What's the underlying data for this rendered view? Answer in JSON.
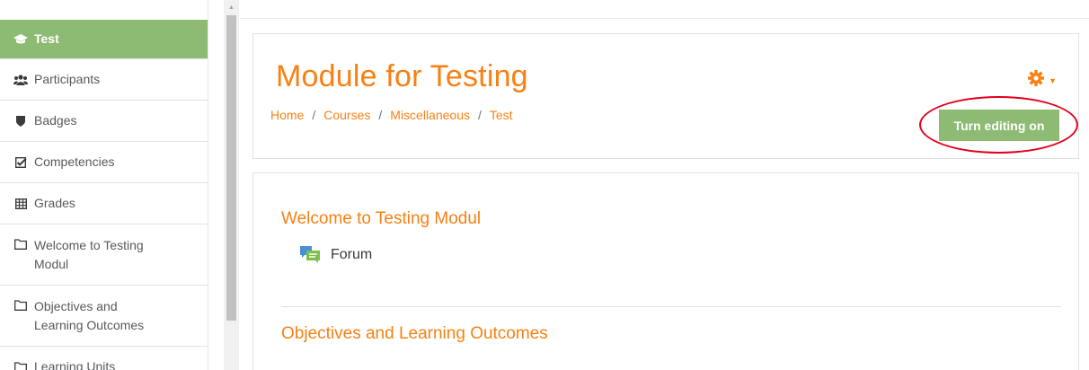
{
  "sidebar": {
    "items": [
      {
        "label": "Test",
        "icon": "graduation-cap-icon",
        "glyph": "🎓",
        "active": true
      },
      {
        "label": "Participants",
        "icon": "users-icon",
        "glyph": "👥"
      },
      {
        "label": "Badges",
        "icon": "shield-icon",
        "glyph": "⛊"
      },
      {
        "label": "Competencies",
        "icon": "checkbox-icon",
        "glyph": "☑"
      },
      {
        "label": "Grades",
        "icon": "table-icon",
        "glyph": "▦"
      },
      {
        "label": "Welcome to Testing\nModul",
        "icon": "folder-icon",
        "glyph": "🗀"
      },
      {
        "label": "Objectives and\nLearning Outcomes",
        "icon": "folder-icon",
        "glyph": "🗀"
      },
      {
        "label": "Learning Units",
        "icon": "folder-icon",
        "glyph": "🗀"
      }
    ]
  },
  "header": {
    "title": "Module for Testing",
    "breadcrumb": [
      "Home",
      "Courses",
      "Miscellaneous",
      "Test"
    ],
    "separator": "/",
    "settings_icon": "gear-icon",
    "edit_button_label": "Turn editing on"
  },
  "content": {
    "sections": [
      {
        "title": "Welcome to Testing Modul"
      },
      {
        "title": "Objectives and Learning Outcomes"
      }
    ],
    "activities": [
      {
        "label": "Forum",
        "icon": "forum-icon"
      }
    ]
  },
  "colors": {
    "accent": "#f98012",
    "active_green": "#8dbb73",
    "annotation_red": "#e2001a"
  }
}
